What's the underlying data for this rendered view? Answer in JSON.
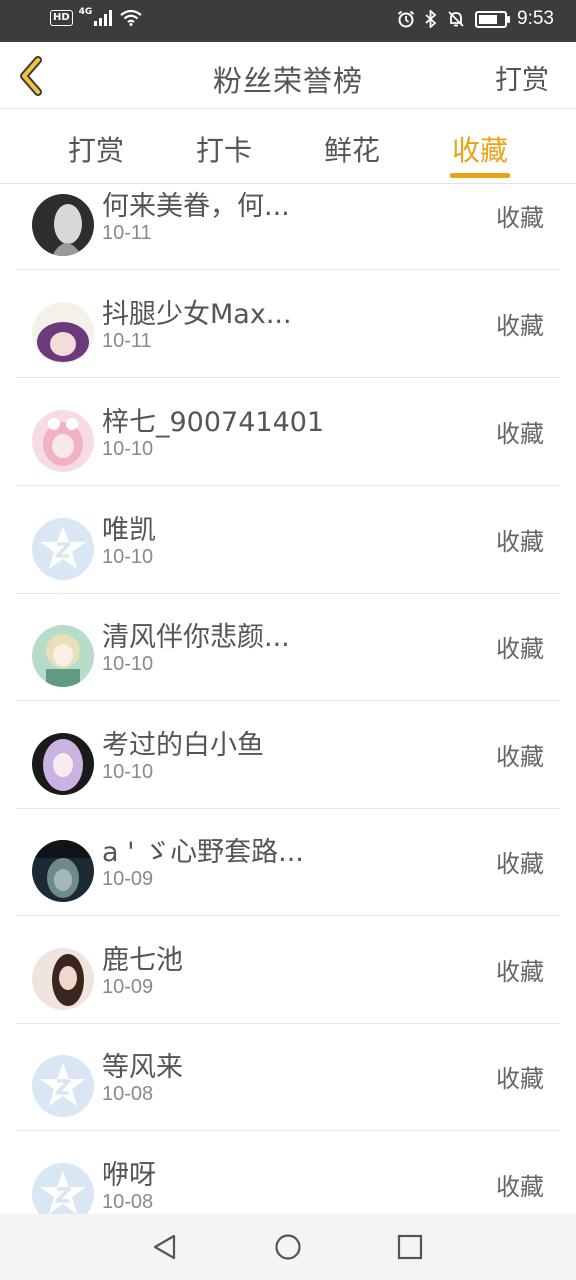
{
  "status_bar": {
    "hd": "HD",
    "network": "4G",
    "time": "9:53",
    "battery_level": 0.9
  },
  "header": {
    "title": "粉丝荣誉榜",
    "action_label": "打赏",
    "accent": "#e8a317"
  },
  "tabs": [
    {
      "label": "打赏",
      "active": false
    },
    {
      "label": "打卡",
      "active": false
    },
    {
      "label": "鲜花",
      "active": false
    },
    {
      "label": "收藏",
      "active": true
    }
  ],
  "list": [
    {
      "name": "何来美眷，何...",
      "date": "10-11",
      "type": "收藏",
      "avatar": "gray-photo"
    },
    {
      "name": "抖腿少女Max...",
      "date": "10-11",
      "type": "收藏",
      "avatar": "purple-hair"
    },
    {
      "name": "梓七_900741401",
      "date": "10-10",
      "type": "收藏",
      "avatar": "pink-anime"
    },
    {
      "name": "唯凯",
      "date": "10-10",
      "type": "收藏",
      "avatar": "default"
    },
    {
      "name": "清风伴你悲颜...",
      "date": "10-10",
      "type": "收藏",
      "avatar": "green-anime"
    },
    {
      "name": "考过的白小鱼",
      "date": "10-10",
      "type": "收藏",
      "avatar": "lavender-anime"
    },
    {
      "name": "a ' ゞ心野套路...",
      "date": "10-09",
      "type": "收藏",
      "avatar": "dark-photo"
    },
    {
      "name": "鹿七池",
      "date": "10-09",
      "type": "收藏",
      "avatar": "girl-photo"
    },
    {
      "name": "等风来",
      "date": "10-08",
      "type": "收藏",
      "avatar": "default"
    },
    {
      "name": "咿呀",
      "date": "10-08",
      "type": "收藏",
      "avatar": "default"
    }
  ]
}
